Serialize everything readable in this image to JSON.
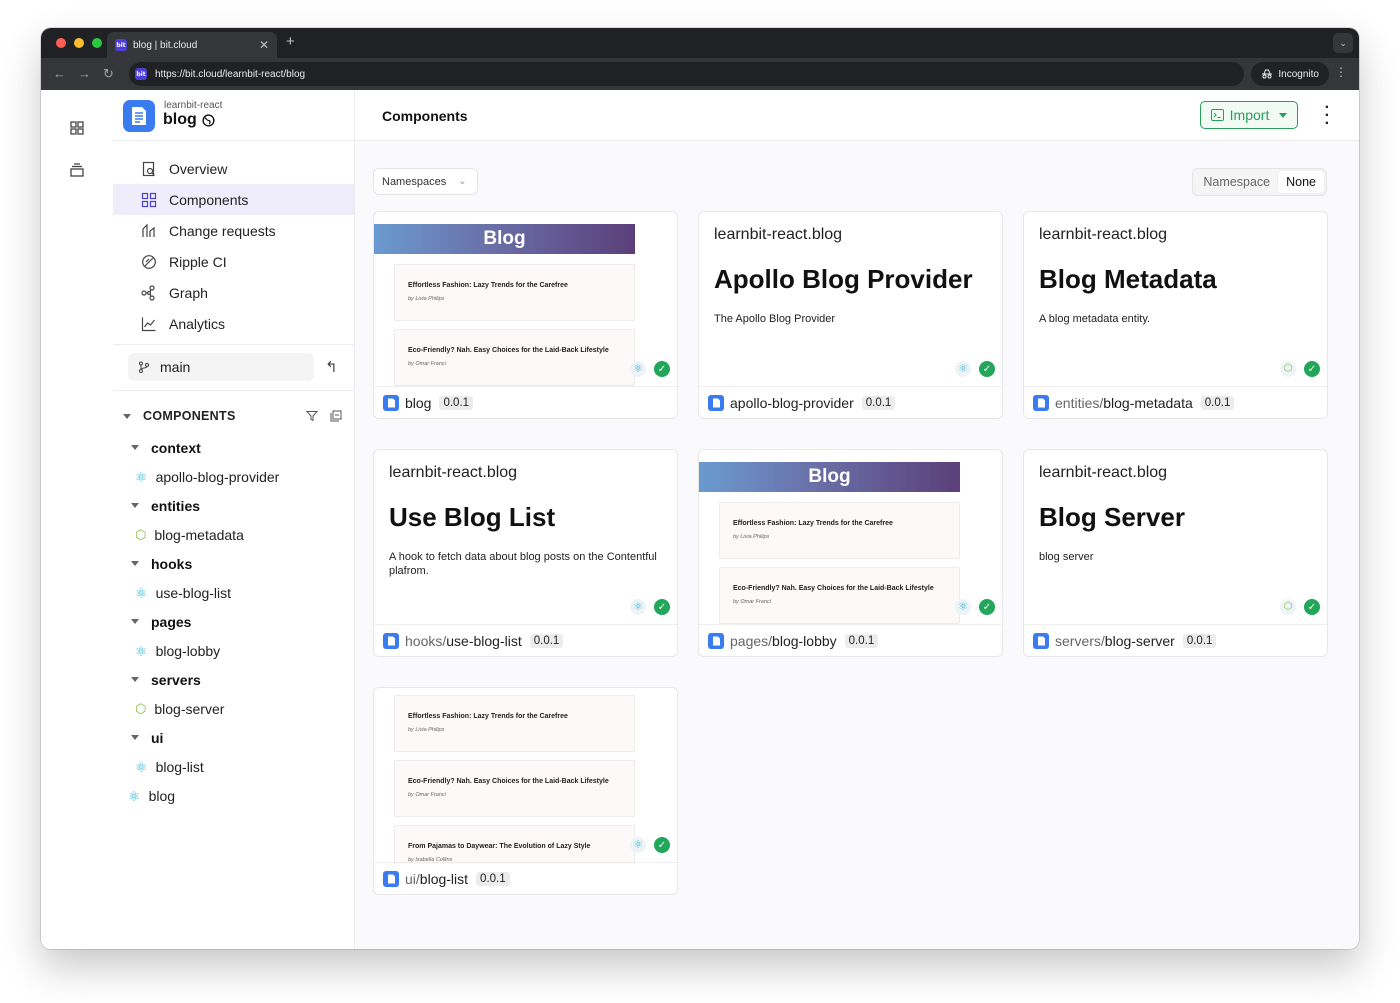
{
  "browser": {
    "tab_title": "blog | bit.cloud",
    "favicon_text": "bit",
    "url": "https://bit.cloud/learnbit-react/blog",
    "incognito_label": "Incognito"
  },
  "scope": {
    "owner": "learnbit-react",
    "name": "blog"
  },
  "nav": {
    "items": [
      {
        "label": "Overview",
        "icon": "overview-icon"
      },
      {
        "label": "Components",
        "icon": "components-grid-icon"
      },
      {
        "label": "Change requests",
        "icon": "change-requests-icon"
      },
      {
        "label": "Ripple CI",
        "icon": "ripple-ci-icon"
      },
      {
        "label": "Graph",
        "icon": "graph-icon"
      },
      {
        "label": "Analytics",
        "icon": "analytics-icon"
      }
    ],
    "branch": "main"
  },
  "tree": {
    "header": "COMPONENTS",
    "folders": [
      {
        "name": "context",
        "items": [
          "apollo-blog-provider"
        ]
      },
      {
        "name": "entities",
        "items": [
          "blog-metadata"
        ]
      },
      {
        "name": "hooks",
        "items": [
          "use-blog-list"
        ]
      },
      {
        "name": "pages",
        "items": [
          "blog-lobby"
        ]
      },
      {
        "name": "servers",
        "items": [
          "blog-server"
        ]
      },
      {
        "name": "ui",
        "items": [
          "blog-list"
        ]
      }
    ],
    "root_item": "blog"
  },
  "main": {
    "title": "Components",
    "import_label": "Import",
    "namespaces_label": "Namespaces",
    "group_by": {
      "option_1": "Namespace",
      "option_2": "None"
    }
  },
  "preview": {
    "banner": "Blog",
    "posts": [
      {
        "title": "Effortless Fashion: Lazy Trends for the Carefree",
        "author": "by Livia Philips"
      },
      {
        "title": "Eco-Friendly? Nah. Easy Choices for the Laid-Back Lifestyle",
        "author": "by Omar Franci"
      },
      {
        "title": "From Pajamas to Daywear: The Evolution of Lazy Style",
        "author": "by Isabella Collins"
      }
    ]
  },
  "cards": [
    {
      "namespace": "",
      "name": "blog",
      "version": "0.0.1"
    },
    {
      "scope_line": "learnbit-react.blog",
      "title": "Apollo Blog Provider",
      "description": "The Apollo Blog Provider",
      "namespace": "",
      "name": "apollo-blog-provider",
      "version": "0.0.1"
    },
    {
      "scope_line": "learnbit-react.blog",
      "title": "Blog Metadata",
      "description": "A blog metadata entity.",
      "namespace": "entities/",
      "name": "blog-metadata",
      "version": "0.0.1"
    },
    {
      "scope_line": "learnbit-react.blog",
      "title": "Use Blog List",
      "description": "A hook to fetch data about blog posts on the Contentful plafrom.",
      "namespace": "hooks/",
      "name": "use-blog-list",
      "version": "0.0.1"
    },
    {
      "namespace": "pages/",
      "name": "blog-lobby",
      "version": "0.0.1"
    },
    {
      "scope_line": "learnbit-react.blog",
      "title": "Blog Server",
      "description": "blog server",
      "namespace": "servers/",
      "name": "blog-server",
      "version": "0.0.1"
    },
    {
      "namespace": "ui/",
      "name": "blog-list",
      "version": "0.0.1"
    }
  ],
  "colors": {
    "accent": "#3a7bf0",
    "success": "#21a65a",
    "import_green": "#2a9d5c",
    "nav_active": "#efedfc"
  }
}
